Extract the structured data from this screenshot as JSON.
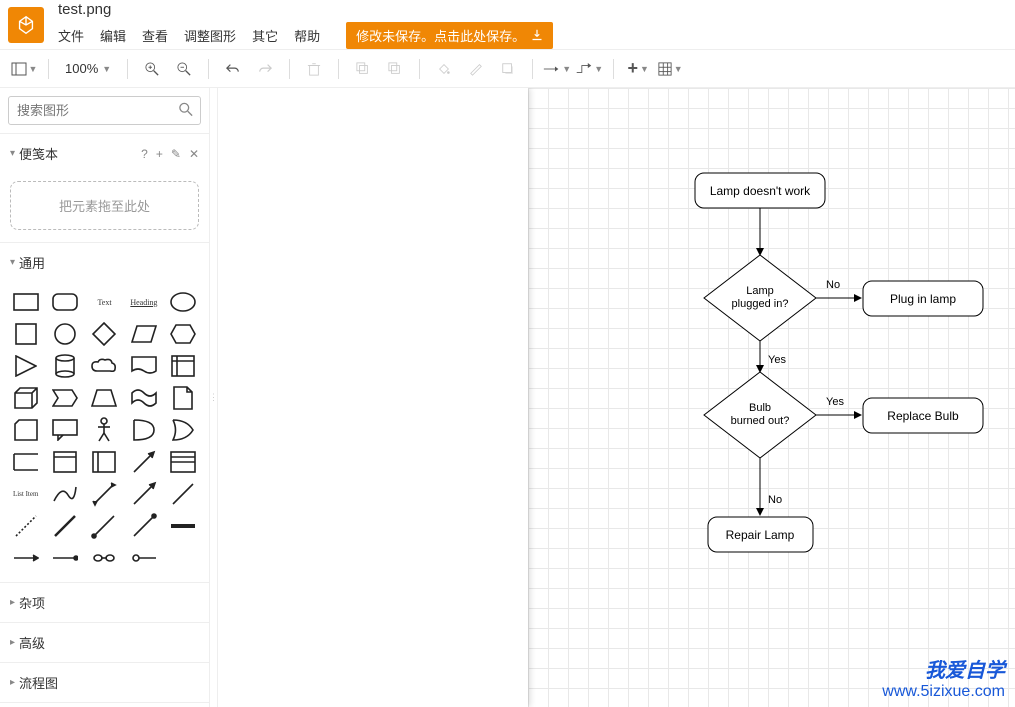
{
  "header": {
    "filename": "test.png",
    "menu": [
      "文件",
      "编辑",
      "查看",
      "调整图形",
      "其它",
      "帮助"
    ],
    "saveButton": "修改未保存。点击此处保存。"
  },
  "toolbar": {
    "zoom": "100%"
  },
  "sidebar": {
    "searchPlaceholder": "搜索图形",
    "scratchpad": {
      "title": "便笺本",
      "dropzone": "把元素拖至此处"
    },
    "general": {
      "title": "通用"
    },
    "categories": [
      "杂项",
      "高级",
      "流程图"
    ]
  },
  "diagram": {
    "nodes": {
      "n1": "Lamp doesn't work",
      "n2": "Lamp\nplugged in?",
      "n3": "Plug in lamp",
      "n4": "Bulb\nburned out?",
      "n5": "Replace Bulb",
      "n6": "Repair Lamp"
    },
    "edges": {
      "no1": "No",
      "yes1": "Yes",
      "yes2": "Yes",
      "no2": "No"
    }
  },
  "watermark": {
    "line1": "我爱自学",
    "line2": "www.5izixue.com"
  }
}
